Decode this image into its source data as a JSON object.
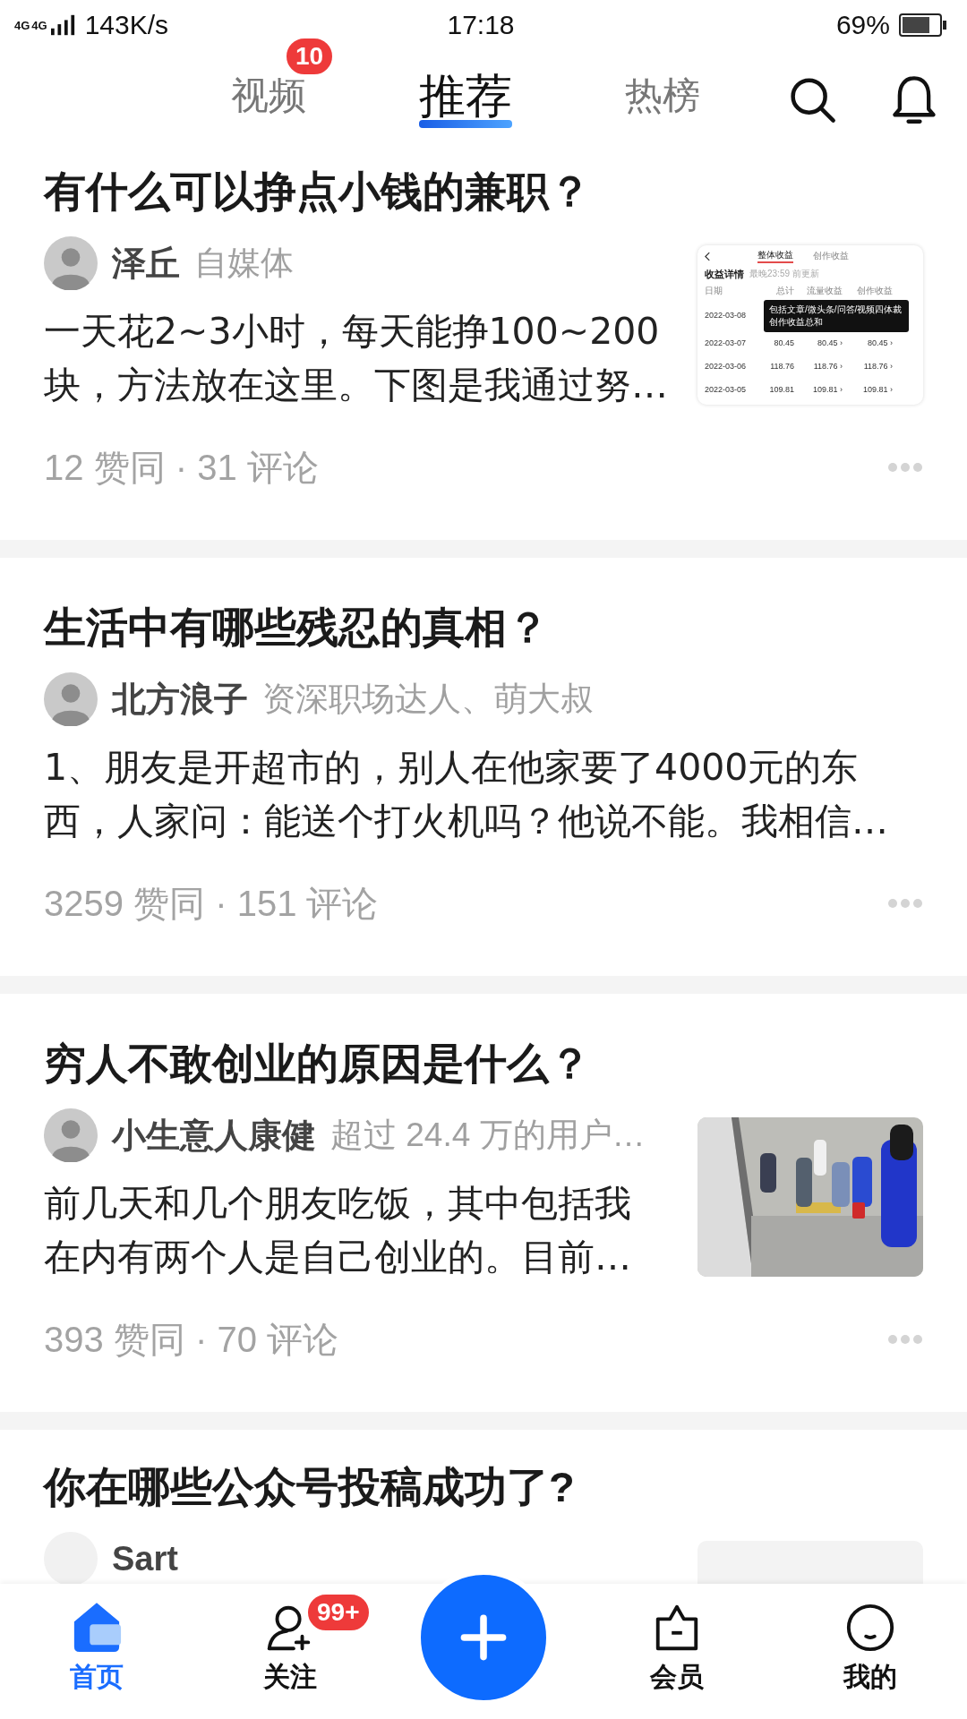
{
  "status_bar": {
    "network": [
      "4G",
      "4G"
    ],
    "speed": "143K/s",
    "time": "17:18",
    "battery": "69%"
  },
  "top_tabs": [
    {
      "label": "视频",
      "badge": "10",
      "selected": false
    },
    {
      "label": "推荐",
      "selected": true
    },
    {
      "label": "热榜",
      "selected": false
    }
  ],
  "feed": [
    {
      "title": "有什么可以挣点小钱的兼职？",
      "author": {
        "name": "泽丘",
        "meta": "自媒体"
      },
      "excerpt": "一天花2~3小时，每天能挣100~200块，方法放在这里。下图是我通过努…",
      "stats": "12 赞同 · 31 评论",
      "thumbnail": {
        "kind": "screenshot",
        "tabs": [
          {
            "label": "整体收益",
            "selected": true
          },
          {
            "label": "创作收益",
            "selected": false
          }
        ],
        "heading": "收益详情",
        "note": "最晚23:59 前更新",
        "columns": [
          "日期",
          "总计",
          "流量收益",
          "创作收益"
        ],
        "tooltip": "包括文章/微头条/问答/视频四体裁创作收益总和",
        "rows": [
          {
            "date": "2022-03-08",
            "values": []
          },
          {
            "date": "2022-03-07",
            "values": [
              "80.45",
              "80.45 ›",
              "80.45 ›"
            ]
          },
          {
            "date": "2022-03-06",
            "values": [
              "118.76",
              "118.76 ›",
              "118.76 ›"
            ]
          },
          {
            "date": "2022-03-05",
            "values": [
              "109.81",
              "109.81 ›",
              "109.81 ›"
            ]
          }
        ]
      }
    },
    {
      "title": "生活中有哪些残忍的真相？",
      "author": {
        "name": "北方浪子",
        "meta": "资深职场达人、萌大叔"
      },
      "excerpt": "1、朋友是开超市的，别人在他家要了4000元的东西，人家问：能送个打火机吗？他说不能。我相信…",
      "stats": "3259 赞同 · 151 评论"
    },
    {
      "title": "穷人不敢创业的原因是什么？",
      "author": {
        "name": "小生意人康健",
        "meta": "超过 24.4 万的用户…"
      },
      "excerpt": "前几天和几个朋友吃饭，其中包括我在内有两个人是自己创业的。目前…",
      "stats": "393 赞同 · 70 评论"
    },
    {
      "title": "你在哪些公众号投稿成功了?",
      "author": {
        "kind": "placeholder",
        "name": "Sart"
      },
      "thumbnail": {
        "kind": "placeholder"
      }
    }
  ],
  "bottom_nav": [
    {
      "kind": "home",
      "label": "首页",
      "selected": true
    },
    {
      "kind": "follow",
      "label": "关注",
      "badge": "99+",
      "selected": false
    },
    {
      "kind": "add"
    },
    {
      "kind": "vip",
      "label": "会员",
      "selected": false
    },
    {
      "kind": "me",
      "label": "我的",
      "selected": false
    }
  ]
}
